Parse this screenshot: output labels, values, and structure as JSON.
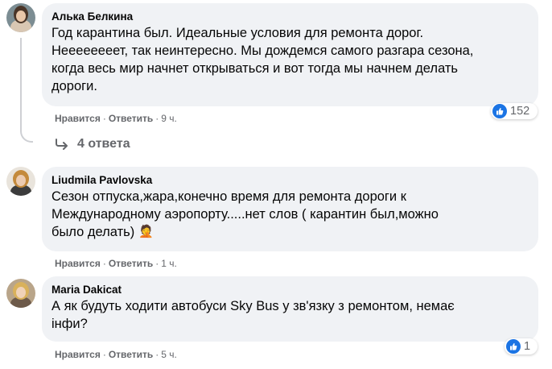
{
  "comments": [
    {
      "author": "Алька Белкина",
      "lines": [
        "Год карантина был. Идеальные условия для ремонта дорог.",
        "Неееееееет, так неинтересно. Мы дождемся самого разгара сезона,",
        "когда весь мир начнет открываться и вот тогда мы начнем делать",
        "дороги."
      ],
      "like_label": "Нравится",
      "reply_label": "Ответить",
      "time": "9 ч.",
      "reaction_count": "152"
    },
    {
      "author": "Liudmila Pavlovska",
      "lines": [
        "Сезон отпуска,жара,конечно время для ремонта дороги к",
        "Международному аэропорту.....нет слов ( карантин был,можно",
        "было делать)"
      ],
      "emoji": "🤦",
      "like_label": "Нравится",
      "reply_label": "Ответить",
      "time": "1 ч."
    },
    {
      "author": "Maria Dakicat",
      "lines": [
        "А як будуть ходити автобуси Sky Bus у зв'язку з ремонтом, немає",
        "інфи?"
      ],
      "like_label": "Нравится",
      "reply_label": "Ответить",
      "time": "5 ч.",
      "reaction_count": "1"
    }
  ],
  "replies_link": "4 ответа",
  "colors": {
    "bubble": "#f0f2f5",
    "secondary_text": "#65676b",
    "like_blue": "#1b74e4",
    "thread_line": "#ced0d4"
  },
  "icons": [
    "like-reaction-icon",
    "reply-arrow-icon",
    "facepalm-emoji-icon"
  ]
}
